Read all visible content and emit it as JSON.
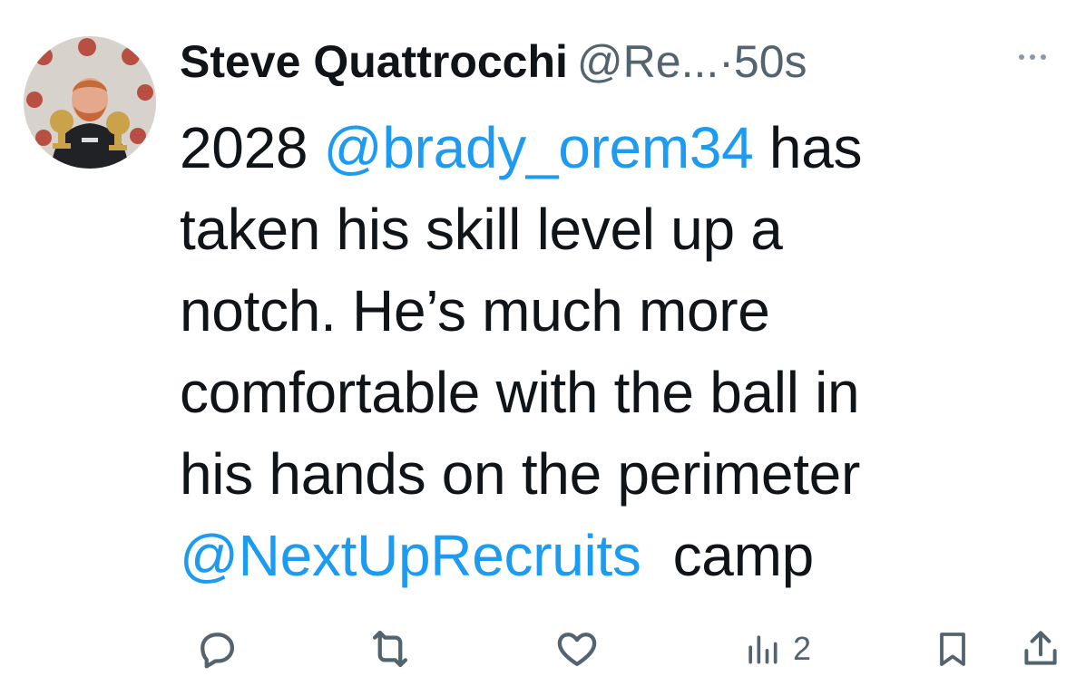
{
  "author": {
    "display_name": "Steve Quattrocchi",
    "handle": "@Re...",
    "separator": "·",
    "time": "50s"
  },
  "tweet": {
    "lines": [
      [
        {
          "text": "2028 ",
          "type": "text"
        },
        {
          "text": "@brady_orem34",
          "type": "mention"
        },
        {
          "text": " has",
          "type": "text"
        }
      ],
      [
        {
          "text": "taken his skill level up a",
          "type": "text"
        }
      ],
      [
        {
          "text": "notch. He’s much more",
          "type": "text"
        }
      ],
      [
        {
          "text": "comfortable with the ball in",
          "type": "text"
        }
      ],
      [
        {
          "text": "his hands on the perimeter",
          "type": "text"
        }
      ],
      [
        {
          "text": "@NextUpRecruits",
          "type": "mention"
        },
        {
          "text": "  camp",
          "type": "text"
        }
      ]
    ]
  },
  "actions": {
    "reply_icon": "reply-icon",
    "retweet_icon": "retweet-icon",
    "like_icon": "heart-icon",
    "views_icon": "views-icon",
    "views_count": "2",
    "bookmark_icon": "bookmark-icon",
    "share_icon": "share-icon"
  },
  "colors": {
    "text": "#0f1419",
    "secondary": "#536471",
    "link": "#1d9bf0",
    "background": "#ffffff"
  }
}
